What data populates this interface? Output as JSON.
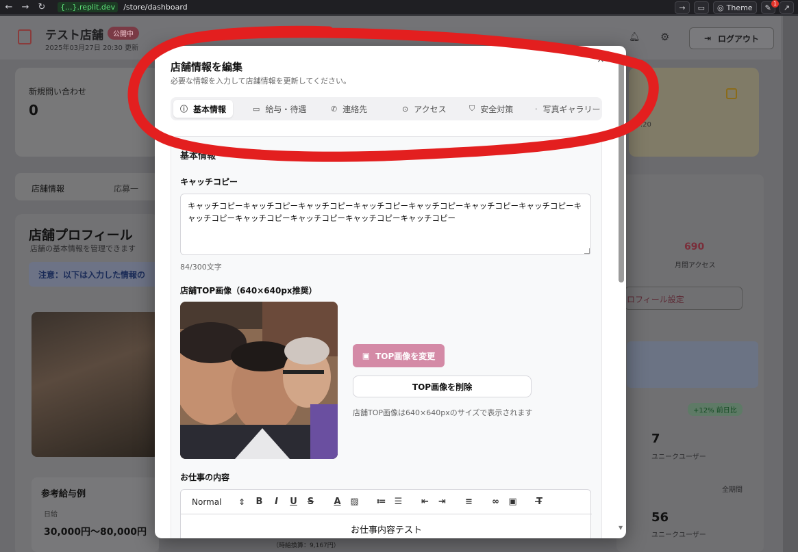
{
  "browser": {
    "host": "{...}.replit.dev",
    "path": "/store/dashboard",
    "theme_label": "Theme",
    "notif_count": "1"
  },
  "dashboard": {
    "store_name": "テスト店舗",
    "status_badge": "公開中",
    "updated": "2025年03月27日 20:30 更新",
    "logout_label": "ログアウト",
    "stat_inquiries_label": "新規問い合わせ",
    "stat_inquiries_value": "0",
    "right_time": "00:20",
    "tab_store_info": "店舗情報",
    "tab_applicants": "応募一",
    "profile_title": "店舗プロフィール",
    "profile_sub": "店舗の基本情報を管理できます",
    "note": "注意：以下は入力した情報の",
    "salary_title": "参考給与例",
    "salary_day_label": "日給",
    "salary_value": "30,000円〜80,000円",
    "hourly_note": "（時給換算：9,167円）",
    "monthly_access_value": "690",
    "monthly_access_label": "月間アクセス",
    "profile_settings_btn": "ロフィール設定",
    "growth_badge": "+12% 前日比",
    "unique_users_1": "7",
    "unique_users_label": "ユニークユーザー",
    "period_label": "全期間",
    "unique_users_2": "56"
  },
  "modal": {
    "title": "店舗情報を編集",
    "subtitle": "必要な情報を入力して店舗情報を更新してください。",
    "close": "×",
    "tabs": [
      {
        "label": "基本情報",
        "icon": "info-icon"
      },
      {
        "label": "給与・待遇",
        "icon": "money-icon"
      },
      {
        "label": "連絡先",
        "icon": "phone-icon"
      },
      {
        "label": "アクセス",
        "icon": "location-icon"
      },
      {
        "label": "安全対策",
        "icon": "shield-icon"
      },
      {
        "label": "写真ギャラリー",
        "icon": "photo-icon"
      }
    ],
    "section_heading_partial": "基本情報",
    "catchcopy_label": "キャッチコピー",
    "catchcopy_value": "キャッチコピーキャッチコピーキャッチコピーキャッチコピーキャッチコピーキャッチコピーキャッチコピーキャッチコピーキャッチコピーキャッチコピーキャッチコピーキャッチコピー",
    "catchcopy_counter": "84/300文字",
    "top_image_label": "店舗TOP画像（640×640px推奨）",
    "change_image_btn": "TOP画像を変更",
    "delete_image_btn": "TOP画像を削除",
    "image_note": "店舗TOP画像は640×640pxのサイズで表示されます",
    "job_content_label": "お仕事の内容",
    "editor_format": "Normal",
    "editor_body": "お仕事内容テスト"
  },
  "colors": {
    "accent_pink": "#d48aa6",
    "annotation_red": "#e31f1f"
  }
}
